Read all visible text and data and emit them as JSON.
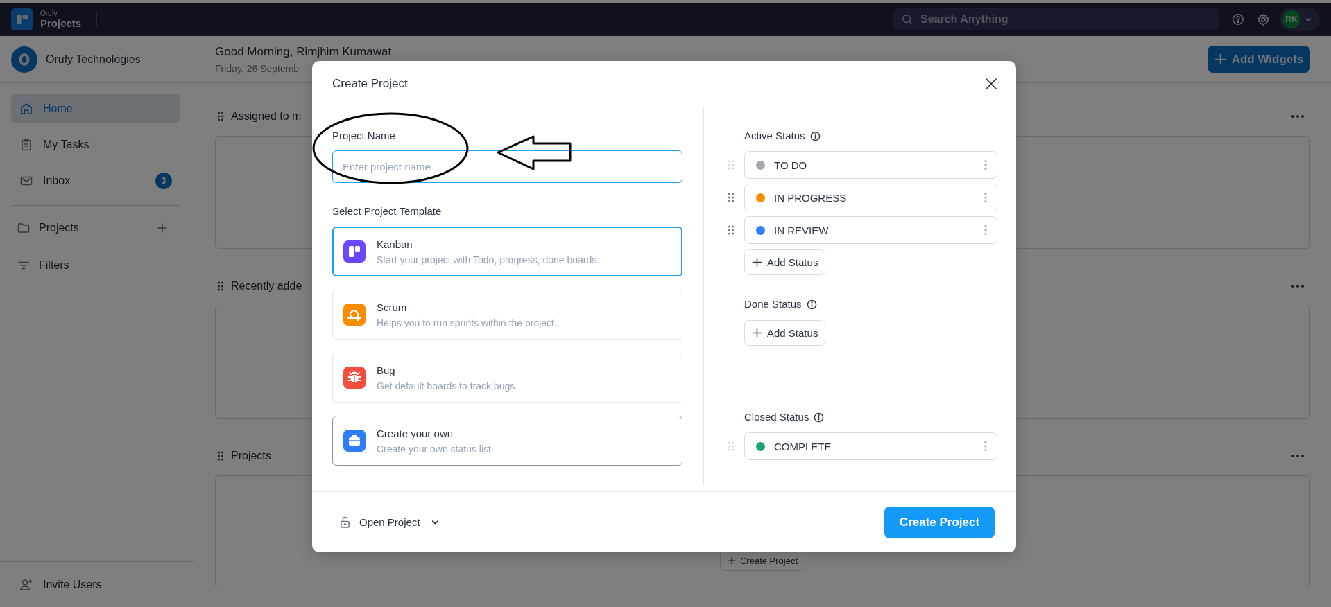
{
  "top_bar": {
    "logo_top": "Orufy",
    "logo_bottom": "Projects",
    "search": {
      "placeholder": "Search Anything"
    },
    "avatar": "RK"
  },
  "sidebar": {
    "workspace": "Orufy Technologies",
    "nav": [
      {
        "label": "Home",
        "kind": "home",
        "selected": true
      },
      {
        "label": "My Tasks",
        "kind": "tasks",
        "selected": false
      },
      {
        "label": "Inbox",
        "kind": "inbox",
        "selected": false,
        "badge": "3"
      }
    ],
    "sections": [
      {
        "label": "Projects",
        "kind": "folder",
        "addable": true
      },
      {
        "label": "Filters",
        "kind": "filter",
        "addable": false
      }
    ],
    "footer": "Invite Users"
  },
  "header": {
    "greeting": "Good Morning, Rimjhim Kumawat",
    "date": "Friday, 26 Septemb",
    "add_button": "Add Widgets"
  },
  "widgets": [
    {
      "title": "Assigned to m"
    },
    {
      "title": "Recently adde"
    },
    {
      "title": "Projects",
      "button": "Create Project"
    }
  ],
  "modal": {
    "title": "Create Project",
    "project_name": {
      "label": "Project Name",
      "placeholder": "Enter project name"
    },
    "template_label": "Select Project Template",
    "templates": [
      {
        "name": "Kanban",
        "description": "Start your project with Todo, progress, done boards.",
        "kind": "kanban",
        "selected": true,
        "hovered": false
      },
      {
        "name": "Scrum",
        "description": "Helps you to run sprints within the project.",
        "kind": "scrum",
        "selected": false,
        "hovered": false
      },
      {
        "name": "Bug",
        "description": "Get default boards to track bugs.",
        "kind": "bug",
        "selected": false,
        "hovered": false
      },
      {
        "name": "Create your own",
        "description": "Create your own status list.",
        "kind": "custom",
        "selected": false,
        "hovered": true
      }
    ],
    "status_groups": [
      {
        "label": "Active Status",
        "statuses": [
          {
            "name": "TO DO",
            "color": "#a3a7ae",
            "draggable": false
          },
          {
            "name": "IN PROGRESS",
            "color": "#fb8c00",
            "draggable": true
          },
          {
            "name": "IN REVIEW",
            "color": "#2f7dff",
            "draggable": true
          }
        ],
        "add_button": "Add Status"
      },
      {
        "label": "Done Status",
        "add_button": "Add Status"
      },
      {
        "label": "Closed Status",
        "statuses": [
          {
            "name": "COMPLETE",
            "color": "#17a578",
            "draggable": false
          }
        ]
      }
    ],
    "visibility": "Open Project",
    "submit": "Create Project"
  },
  "annotations": {
    "ellipse": true,
    "arrow": true
  }
}
